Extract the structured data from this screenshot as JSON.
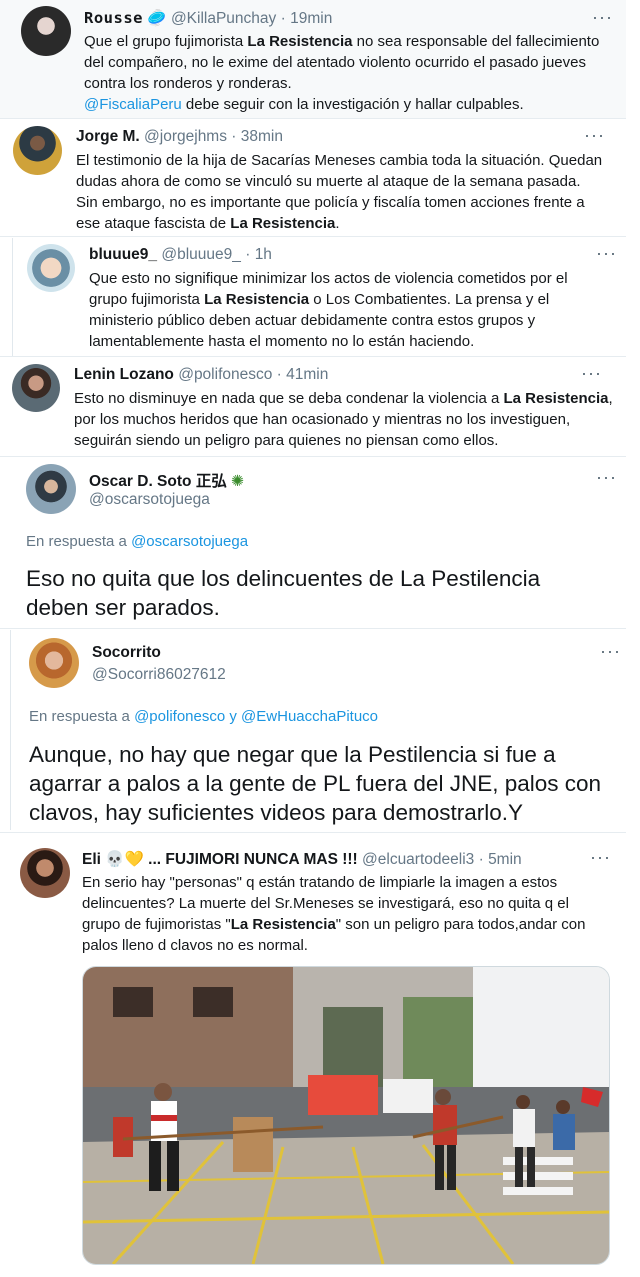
{
  "tweets": [
    {
      "name": "Rousse",
      "emoji": "🥏",
      "handle": "@KillaPunchay",
      "time": "19min",
      "text": [
        {
          "t": "Que el grupo fujimorista "
        },
        {
          "t": "La Resistencia",
          "b": true
        },
        {
          "t": " no sea responsable del fallecimiento del compañero, no le exime del atentado violento ocurrido el pasado jueves contra los ronderos y ronderas."
        },
        {
          "br": true
        },
        {
          "t": "@FiscaliaPeru",
          "link": true
        },
        {
          "t": " debe seguir con la investigación y hallar culpables."
        }
      ]
    },
    {
      "name": "Jorge M.",
      "handle": "@jorgejhms",
      "time": "38min",
      "text": [
        {
          "t": "El testimonio de la hija de Sacarías Meneses cambia toda la situación. Quedan dudas ahora de como se vinculó su muerte al ataque de la semana pasada. Sin embargo, no es importante que policía y fiscalía tomen acciones frente a ese ataque fascista de "
        },
        {
          "t": "La Resistencia",
          "b": true
        },
        {
          "t": "."
        }
      ]
    },
    {
      "name": "bluuue9_",
      "handle": "@bluuue9_",
      "time": "1h",
      "text": [
        {
          "t": "Que esto no signifique minimizar los actos de violencia cometidos por el grupo fujimorista "
        },
        {
          "t": "La Resistencia",
          "b": true
        },
        {
          "t": " o Los Combatientes. La prensa y el ministerio público deben actuar debidamente contra estos grupos y lamentablemente hasta el momento no lo están haciendo."
        }
      ]
    },
    {
      "name": "Lenin Lozano",
      "handle": "@polifonesco",
      "time": "41min",
      "text": [
        {
          "t": "Esto no disminuye en nada que se deba condenar la violencia a "
        },
        {
          "t": "La Resistencia",
          "b": true
        },
        {
          "t": ", por los muchos heridos que han ocasionado y mientras no los investiguen, seguirán siendo un peligro para quienes no piensan como ellos."
        }
      ]
    },
    {
      "name": "Oscar D. Soto",
      "name_suffix": "正弘",
      "handle": "@oscarsotojuega",
      "reply_prefix": "En respuesta a",
      "reply_to": [
        "@oscarsotojuega"
      ],
      "text": "Eso no quita que los delincuentes de La Pestilencia deben ser parados."
    },
    {
      "name": "Socorrito",
      "handle": "@Socorri86027612",
      "reply_prefix": "En respuesta a",
      "reply_to": [
        "@polifonesco",
        "@EwHuacchaPituco"
      ],
      "reply_join": "y",
      "text": "Aunque, no hay que negar que la Pestilencia si fue a agarrar a palos a la gente de PL fuera del JNE, palos con clavos, hay suficientes videos para demostrarlo.Y"
    },
    {
      "name": "Eli",
      "emoji": "💀💛 ... FUJIMORI NUNCA MAS !!!",
      "handle": "@elcuartodeeli3",
      "time": "5min",
      "text": [
        {
          "t": "En serio hay \"personas\" q están tratando de limpiarle la imagen a estos delincuentes? La muerte del Sr.Meneses se investigará, eso no quita q el grupo de fujimoristas \""
        },
        {
          "t": "La Resistencia",
          "b": true
        },
        {
          "t": "\" son un peligro para todos,andar con palos lleno d clavos no es normal."
        }
      ]
    }
  ],
  "ui": {
    "more_label": "···",
    "dot": "·"
  }
}
